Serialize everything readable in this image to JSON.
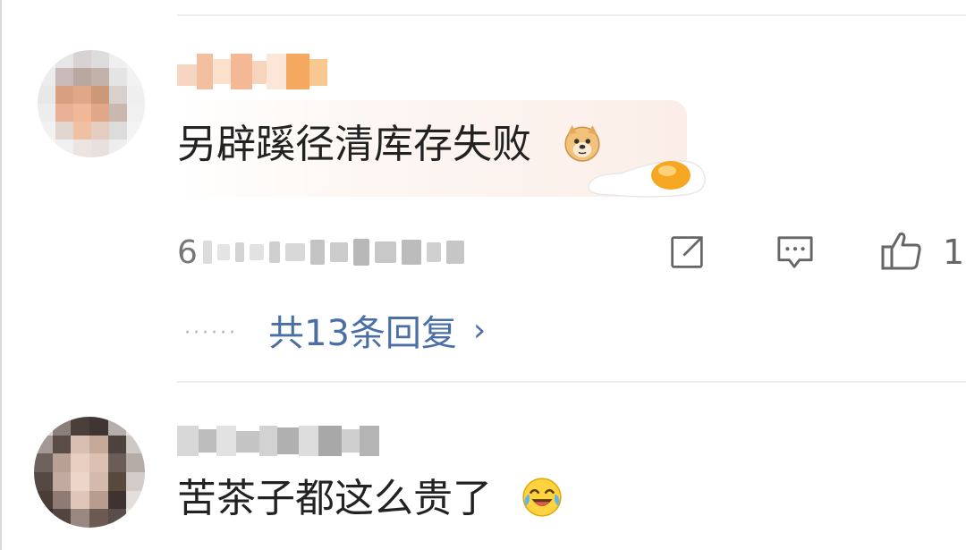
{
  "comments": [
    {
      "text": "另辟蹊径清库存失败",
      "emoji_icon": "doge-icon",
      "sticker_icon": "fried-egg-icon",
      "meta_prefix": "6",
      "like_count": "1",
      "reply_summary": "共13条回复",
      "reply_chevron": "›"
    },
    {
      "text": "苦茶子都这么贵了",
      "emoji_icon": "laughing-crying-icon"
    }
  ],
  "icons": {
    "share": "share-icon",
    "comment": "comment-icon",
    "like": "thumbs-up-icon"
  },
  "colors": {
    "link": "#4a6fa5",
    "text": "#222222",
    "meta": "#777777",
    "divider": "#eeeeee"
  }
}
